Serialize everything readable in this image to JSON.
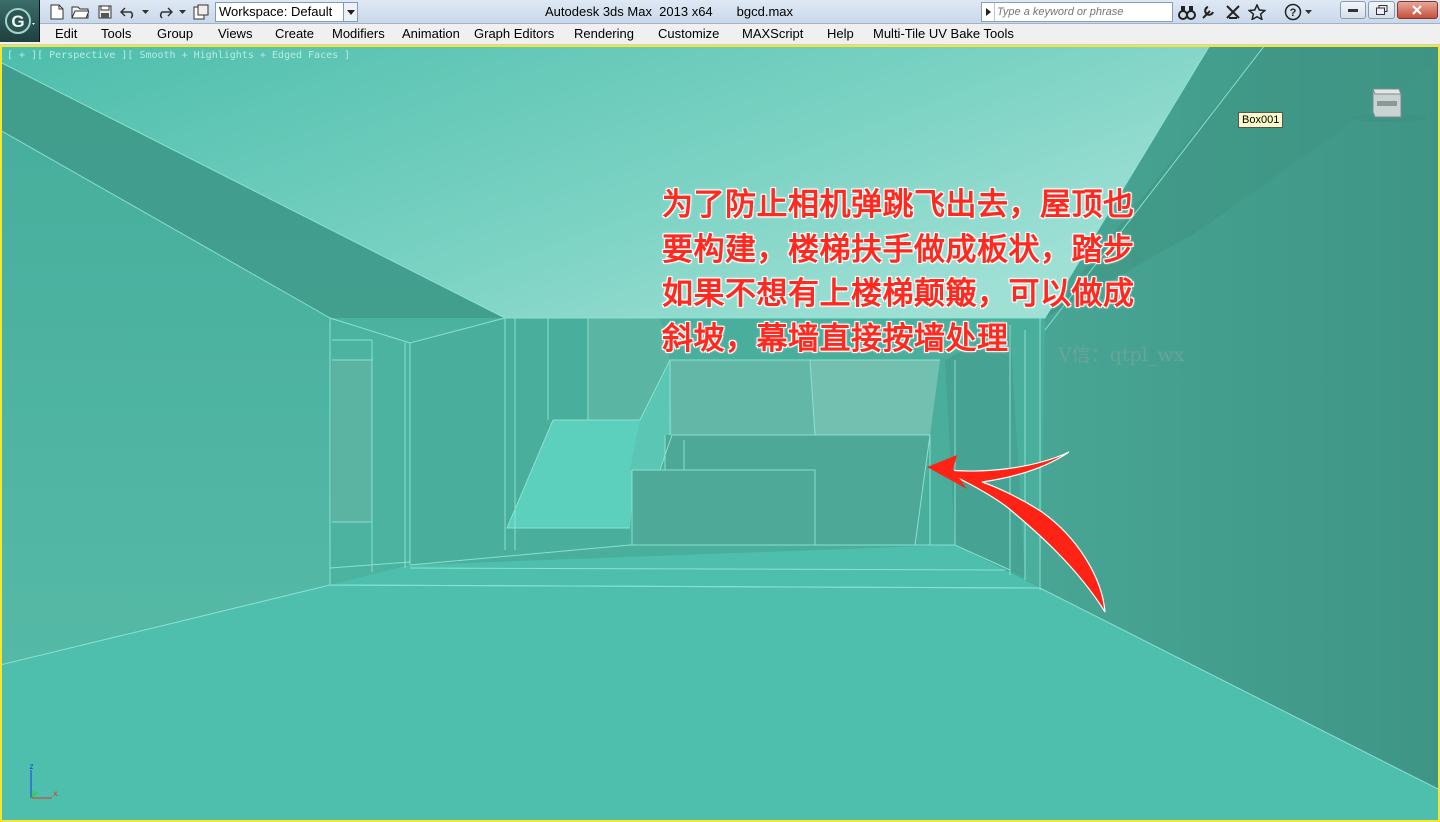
{
  "titlebar": {
    "workspace_label": "Workspace: Default",
    "app_title": "Autodesk 3ds Max  2013 x64",
    "file_name": "bgcd.max",
    "search_placeholder": "Type a keyword or phrase"
  },
  "menubar": {
    "items": [
      "Edit",
      "Tools",
      "Group",
      "Views",
      "Create",
      "Modifiers",
      "Animation",
      "Graph Editors",
      "Rendering",
      "Customize",
      "MAXScript",
      "Help",
      "Multi-Tile UV Bake Tools"
    ]
  },
  "viewport": {
    "label": "[ + ][ Perspective ][ Smooth + Highlights + Edged Faces ]",
    "tooltip": "Box001",
    "annotation": "为了防止相机弹跳飞出去，屋顶也\n要构建，楼梯扶手做成板状，踏步\n如果不想有上楼梯颠簸，可以做成\n斜坡，幕墙直接按墙处理",
    "watermark": "V信：qtpl_wx",
    "axis": {
      "z": "z",
      "y": "y",
      "x": "x"
    },
    "colors": {
      "active_border": "#f5e632",
      "annotation": "#ff2a1f",
      "mesh": "#4fbfad"
    }
  }
}
